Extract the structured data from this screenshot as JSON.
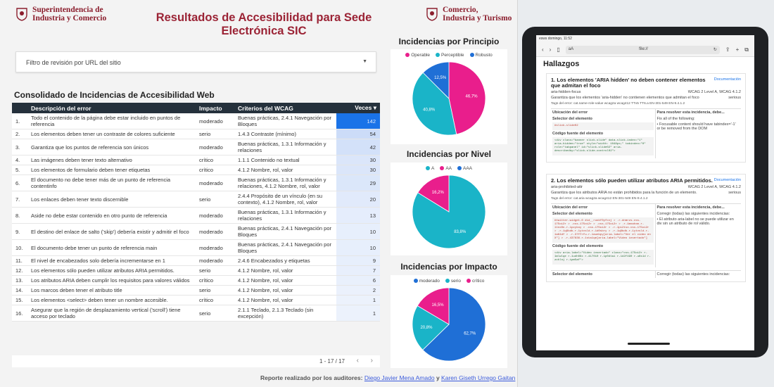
{
  "header": {
    "logo_left_line1": "Superintendencia de",
    "logo_left_line2": "Industria y Comercio",
    "title": "Resultados de Accesibilidad para Sede Electrónica SIC",
    "logo_right_line1": "Comercio,",
    "logo_right_line2": "Industria y Turismo"
  },
  "filter": {
    "label": "Filtro de revisión por URL del sitio"
  },
  "table": {
    "title": "Consolidado de Incidencias de Accesibilidad Web",
    "columns": [
      "Descripción del error",
      "Impacto",
      "Criterios del WCAG",
      "Veces ▾"
    ],
    "rows": [
      {
        "n": "1.",
        "desc": "Todo el contenido de la página debe estar incluido en puntos de referencia",
        "impact": "moderado",
        "crit": "Buenas prácticas, 2.4.1 Navegación por Bloques",
        "veces": "142"
      },
      {
        "n": "2.",
        "desc": "Los elementos deben tener un contraste de colores suficiente",
        "impact": "serio",
        "crit": "1.4.3 Contraste (mínimo)",
        "veces": "54"
      },
      {
        "n": "3.",
        "desc": "Garantiza que los puntos de referencia son únicos",
        "impact": "moderado",
        "crit": "Buenas prácticas, 1.3.1 Información y relaciones",
        "veces": "42"
      },
      {
        "n": "4.",
        "desc": "Las imágenes deben tener texto alternativo",
        "impact": "crítico",
        "crit": "1.1.1 Contenido no textual",
        "veces": "30"
      },
      {
        "n": "5.",
        "desc": "Los elementos de formulario deben tener etiquetas",
        "impact": "crítico",
        "crit": "4.1.2 Nombre, rol, valor",
        "veces": "30"
      },
      {
        "n": "6.",
        "desc": "El documento no debe tener más de un punto de referencia contentinfo",
        "impact": "moderado",
        "crit": "Buenas prácticas, 1.3.1 Información y relaciones, 4.1.2 Nombre, rol, valor",
        "veces": "29"
      },
      {
        "n": "7.",
        "desc": "Los enlaces deben tener texto discernible",
        "impact": "serio",
        "crit": "2.4.4 Propósito de un vínculo (en su contexto), 4.1.2 Nombre, rol, valor",
        "veces": "20"
      },
      {
        "n": "8.",
        "desc": "Aside no debe estar contenido en otro punto de referencia",
        "impact": "moderado",
        "crit": "Buenas prácticas, 1.3.1 Información y relaciones",
        "veces": "13"
      },
      {
        "n": "9.",
        "desc": "El destino del enlace de salto ('skip') debería existir y admitir el foco",
        "impact": "moderado",
        "crit": "Buenas prácticas, 2.4.1 Navegación por Bloques",
        "veces": "10"
      },
      {
        "n": "10.",
        "desc": "El documento debe tener un punto de referencia main",
        "impact": "moderado",
        "crit": "Buenas prácticas, 2.4.1 Navegación por Bloques",
        "veces": "10"
      },
      {
        "n": "11.",
        "desc": "El nivel de encabezados solo debería incrementarse en 1",
        "impact": "moderado",
        "crit": "2.4.6 Encabezados y etiquetas",
        "veces": "9"
      },
      {
        "n": "12.",
        "desc": "Los elementos sólo pueden utilizar atributos ARIA permitidos.",
        "impact": "serio",
        "crit": "4.1.2 Nombre, rol, valor",
        "veces": "7"
      },
      {
        "n": "13.",
        "desc": "Los atributos ARIA deben cumplir los requisitos para valores válidos",
        "impact": "crítico",
        "crit": "4.1.2 Nombre, rol, valor",
        "veces": "6"
      },
      {
        "n": "14.",
        "desc": "Los marcos deben tener el atributo title",
        "impact": "serio",
        "crit": "4.1.2 Nombre, rol, valor",
        "veces": "2"
      },
      {
        "n": "15.",
        "desc": "Los elementos <select> deben tener un nombre accesible.",
        "impact": "crítico",
        "crit": "4.1.2 Nombre, rol, valor",
        "veces": "1"
      },
      {
        "n": "16.",
        "desc": "Asegurar que la región de desplazamiento vertical ('scroll') tiene acceso por teclado",
        "impact": "serio",
        "crit": "2.1.1 Teclado, 2.1.3 Teclado (sin excepción)",
        "veces": "1"
      }
    ],
    "pager": "1 - 17 / 17"
  },
  "footer": {
    "text": "Reporte realizado por los auditores:",
    "auditor1": "Diego Javier Mena Amado",
    "sep": "y",
    "auditor2": "Karen Giseth Urrego Gaitan"
  },
  "chart_data": [
    {
      "type": "pie",
      "title": "Incidencias por Principio",
      "categories": [
        "Operable",
        "Perceptible",
        "Robusto"
      ],
      "values": [
        46.7,
        40.8,
        12.5
      ],
      "labels": [
        "46,7%",
        "40,8%",
        "12,5%"
      ],
      "colors": [
        "#e91e8c",
        "#1ab4c8",
        "#1f6fd6"
      ]
    },
    {
      "type": "pie",
      "title": "Incidencias por Nivel",
      "categories": [
        "A",
        "AA",
        "AAA"
      ],
      "values": [
        83.8,
        16.2,
        0
      ],
      "labels": [
        "83,8%",
        "16,2%",
        ""
      ],
      "colors": [
        "#1ab4c8",
        "#e91e8c",
        "#1f6fd6"
      ]
    },
    {
      "type": "pie",
      "title": "Incidencias por Impacto",
      "categories": [
        "moderado",
        "serio",
        "crítico"
      ],
      "values": [
        62.7,
        20.8,
        16.5
      ],
      "labels": [
        "62,7%",
        "20,8%",
        "16,5%"
      ],
      "colors": [
        "#1f6fd6",
        "#1ab4c8",
        "#e91e8c"
      ]
    }
  ],
  "tablet": {
    "status": "esws domingo, 11:52",
    "url": "aA",
    "url_right": "file://",
    "heading": "Hallazgos",
    "doc_label": "Documentación",
    "card1": {
      "title": "1. Los elementos 'ARIA hidden' no deben contener elementos que admitan el foco",
      "rule": "aria-hidden-focus",
      "wcag": "WCAG 2 Level A, WCAG 4.1.2",
      "desc": "Garantiza que los elementos 'aria-hidden' no contienen elementos que admitan el foco",
      "severity": "serious",
      "tags": "Tags del error: cat.name-role-value  wcag2a  wcag412  TTv5  TT6.a  EN-301-549  EN-9.4.1.2",
      "col1": "Ubicación del error",
      "col2": "Para resolver esta incidencia, debe...",
      "selector": "Selector del elemento",
      "selector_val": "#slick-slide02",
      "source": "Código fuente del elemento",
      "code": "<div class=\"banner slick-slide\" data-slick-index=\"1\" aria-hidden=\"true\" style=\"width: 1048px;\" tabindex=\"0\" role=\"tabpanel\" id=\"slick-slide02\" aria-describedby=\"slick-slide-control02\">",
      "fix_title": "Fix all of the following:",
      "fix_item": "Focusable content should have tabindex='-1' or be removed from the DOM"
    },
    "card2": {
      "title": "2. Los elementos sólo pueden utilizar atributos ARIA permitidos.",
      "rule": "aria-prohibited-attr",
      "wcag": "WCAG 2 Level A, WCAG 4.1.2",
      "desc": "Garantiza que los atributos ARIA no están prohibidos para la función de un elemento.",
      "severity": "serious",
      "tags": "Tags del error: cat.aria  wcag2a  wcag412  EN-301-549  EN-9.4.1.2",
      "col1": "Ubicación del error",
      "col2": "Para resolver esta incidencia, debe...",
      "selector": "Selector del elemento",
      "code": "#twitter-widget-0 #id__ruokf0yfcxj > .r-dnmrzs.css-175oi2r > .css-175oi2r > .css-175oi2r > .r-1mnahxm.r-1tnx0n.r-1pzykoy > .css-175oi2r > .r-1pi2tsx.css-175oi2r > .r-1q9bdb.r-1ytvsld.r-1d0sbry > .r-1q9bdb.r-1ytvsld.r-1a64df > .r-37ffrfu.r-1aunbpy[aria-label=\"Ver el video en X\"] > .r-437836.r-1sta1qe[aria-label=\"Video insertado\"]",
      "fix_title": "Corregir (todas) las siguientes incidencias:",
      "fix_item": "El atributo aria-label no se puede utilizar en div sin un atributo de rol válido.",
      "source": "Código fuente del elemento",
      "code2": "<div aria-label=\"Video insertado\" class=\"css-175oi2r r-1mlwlqe r-1udh08x r-417010 r-1p0dtai r-1d2f490 r-u8s1d r-zchlnj r-ipm5af\">",
      "next": "Selector del elemento",
      "next_fix": "Corregir (todas) las siguientes incidencias:"
    }
  }
}
